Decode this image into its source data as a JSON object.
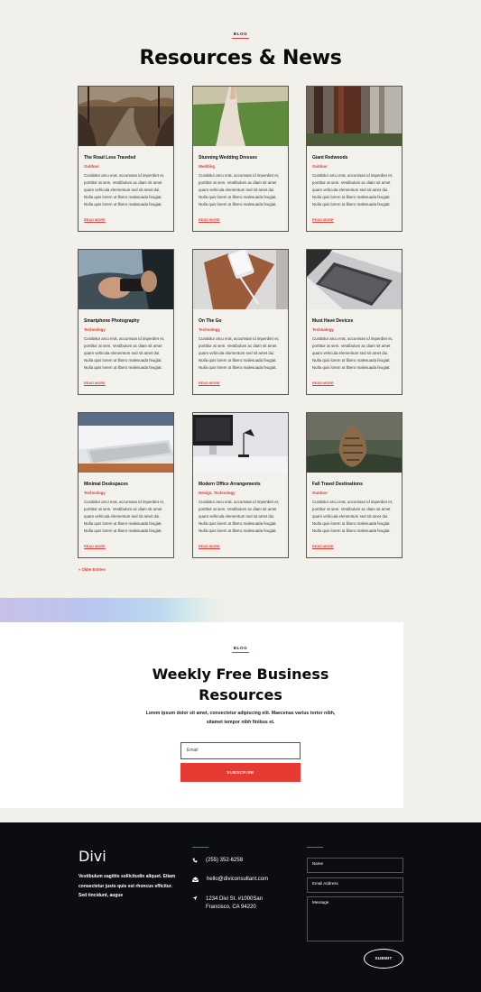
{
  "blog_section": {
    "eyebrow": "BLOG",
    "title": "Resources & News",
    "posts": [
      {
        "title": "The Road Less Traveled",
        "category": "Outdoor",
        "excerpt": "Curabitur arcu erat, accumsan id imperdiet et, porttitor at sem. Vestibulum ac diam sit amet quam vehicula elementum sed sit amet dui. Nulla quis lorem ut libero malesuada feugiat. Nulla quis lorem ut libero malesuada feugiat.",
        "read_more": "READ MORE"
      },
      {
        "title": "Stunning Wedding Dresses",
        "category": "Wedding",
        "excerpt": "Curabitur arcu erat, accumsan id imperdiet et, porttitor at sem. Vestibulum ac diam sit amet quam vehicula elementum sed sit amet dui. Nulla quis lorem ut libero malesuada feugiat. Nulla quis lorem ut libero malesuada feugiat.",
        "read_more": "READ MORE"
      },
      {
        "title": "Giant Redwoods",
        "category": "Outdoor",
        "excerpt": "Curabitur arcu erat, accumsan id imperdiet et, porttitor at sem. Vestibulum ac diam sit amet quam vehicula elementum sed sit amet dui. Nulla quis lorem ut libero malesuada feugiat. Nulla quis lorem ut libero malesuada feugiat.",
        "read_more": "READ MORE"
      },
      {
        "title": "Smartphone Photography",
        "category": "Technology",
        "excerpt": "Curabitur arcu erat, accumsan id imperdiet et, porttitor at sem. Vestibulum ac diam sit amet quam vehicula elementum sed sit amet dui. Nulla quis lorem ut libero malesuada feugiat. Nulla quis lorem ut libero malesuada feugiat.",
        "read_more": "READ MORE"
      },
      {
        "title": "On The Go",
        "category": "Technology",
        "excerpt": "Curabitur arcu erat, accumsan id imperdiet et, porttitor at sem. Vestibulum ac diam sit amet quam vehicula elementum sed sit amet dui. Nulla quis lorem ut libero malesuada feugiat. Nulla quis lorem ut libero malesuada feugiat.",
        "read_more": "READ MORE"
      },
      {
        "title": "Must Have Devices",
        "category": "Technology",
        "excerpt": "Curabitur arcu erat, accumsan id imperdiet et, porttitor at sem. Vestibulum ac diam sit amet quam vehicula elementum sed sit amet dui. Nulla quis lorem ut libero malesuada feugiat. Nulla quis lorem ut libero malesuada feugiat.",
        "read_more": "READ MORE"
      },
      {
        "title": "Minimal Deskspaces",
        "category": "Technology",
        "excerpt": "Curabitur arcu erat, accumsan id imperdiet et, porttitor at sem. Vestibulum ac diam sit amet quam vehicula elementum sed sit amet dui. Nulla quis lorem ut libero malesuada feugiat. Nulla quis lorem ut libero malesuada feugiat.",
        "read_more": "READ MORE"
      },
      {
        "title": "Modern Office Arrangements",
        "category": "Design, Technology",
        "excerpt": "Curabitur arcu erat, accumsan id imperdiet et, porttitor at sem. Vestibulum ac diam sit amet quam vehicula elementum sed sit amet dui. Nulla quis lorem ut libero malesuada feugiat. Nulla quis lorem ut libero malesuada feugiat.",
        "read_more": "READ MORE"
      },
      {
        "title": "Fall Travel Destinations",
        "category": "Outdoor",
        "excerpt": "Curabitur arcu erat, accumsan id imperdiet et, porttitor at sem. Vestibulum ac diam sit amet quam vehicula elementum sed sit amet dui. Nulla quis lorem ut libero malesuada feugiat. Nulla quis lorem ut libero malesuada feugiat.",
        "read_more": "READ MORE"
      }
    ],
    "older_entries": "« Older Entries"
  },
  "newsletter": {
    "eyebrow": "BLOG",
    "title_line1": "Weekly Free Business",
    "title_line2": "Resources",
    "lead": "Lorem ipsum dolor sit amet, consectetur adipiscing elit. Maecenas varius tortor nibh, sitamet tempor nibh finibus et.",
    "email_placeholder": "Email",
    "subscribe_label": "SUBSCRIBE"
  },
  "footer": {
    "logo": "Divi",
    "about": "Vestibulum sagittis sollicitudin aliquet. Etiam consectetur justo quis est rhoncus efficitur. Sed tincidunt, augue",
    "phone": "(255) 352-6258",
    "email": "hello@diviconsultant.com",
    "address_line1": "1234 Divi St. #1000San",
    "address_line2": "Francisco, CA 94220",
    "form": {
      "name_placeholder": "Name",
      "email_placeholder": "Email Address",
      "message_placeholder": "Message",
      "submit_label": "SUBMIT"
    }
  },
  "colors": {
    "accent": "#e63a32",
    "page_bg": "#f1f0ea",
    "footer_bg": "#0b0d10"
  }
}
